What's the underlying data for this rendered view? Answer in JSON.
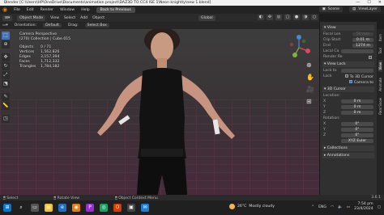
{
  "titlebar": {
    "title": "Blender [C:\\Users\\HP\\OneDrive\\Documents\\animation project\\DAZ3D TO CC4 ISE 1\\Neon knightly\\new 1.blend]",
    "controls": [
      "—",
      "☐",
      "✕"
    ]
  },
  "menubar": {
    "items": [
      "File",
      "Edit",
      "Render",
      "Window",
      "Help"
    ],
    "active_tab": "Back to Previous",
    "scene_label": "Scene",
    "viewlayer_label": "ViewLayer"
  },
  "header": {
    "mode": "Object Mode",
    "menus": [
      "View",
      "Select",
      "Add",
      "Object"
    ],
    "orientation_label": "Global"
  },
  "toolsettings": {
    "orientation_label": "Orientation:",
    "orientation_value": "Default",
    "drag_label": "Drag:",
    "drag_value": "Select Box"
  },
  "overlay": {
    "view_name": "Camera Perspective",
    "collection": "(270) Collection | Cube.015",
    "stats": [
      {
        "label": "Objects",
        "value": "0 / 71"
      },
      {
        "label": "Vertices",
        "value": "1,562,826"
      },
      {
        "label": "Edges",
        "value": "3,157,394"
      },
      {
        "label": "Faces",
        "value": "1,712,332"
      },
      {
        "label": "Triangles",
        "value": "1,784,182"
      }
    ]
  },
  "npanel": {
    "view_title": "View",
    "focal_length_label": "Focal Len",
    "focal_length_value": "50 mm",
    "clip_start_label": "Clip Start",
    "clip_start_value": "0.01 m",
    "clip_end_label": "End",
    "clip_end_value": "1274 m",
    "local_camera_label": "Local Ca",
    "render_region_label": "Render Re",
    "view_lock_title": "View Lock",
    "lock_to_object_label": "Lock to",
    "lock_label": "Lock",
    "lock_3d_cursor": "To 3D Cursor",
    "lock_camera": "Camera to",
    "cursor_title": "3D Cursor",
    "location_label": "Location:",
    "loc_x": "0 m",
    "loc_y": "0 m",
    "loc_z": "0 m",
    "rotation_label": "Rotation:",
    "rot_x": "0°",
    "rot_y": "0°",
    "rot_z": "0°",
    "rotation_mode": "XYZ Euler",
    "collections_title": "Collections",
    "annotations_title": "Annotations"
  },
  "sidetabs": [
    "Item",
    "Tool",
    "View",
    "Animate",
    "Real Snow"
  ],
  "statusbar": {
    "select_label": "Select",
    "rotate_label": "Rotate View",
    "context_label": "Object Context Menu",
    "version": "3.6.1"
  },
  "taskbar": {
    "weather_temp": "26°C",
    "weather_desc": "Mostly cloudy",
    "language": "ENG",
    "time": "7:54 pm",
    "date": "23/4/2024"
  },
  "colors": {
    "viewport_floor": "#4a2a3c",
    "accent": "#4772b3",
    "blender_orange": "#e87d0d"
  }
}
